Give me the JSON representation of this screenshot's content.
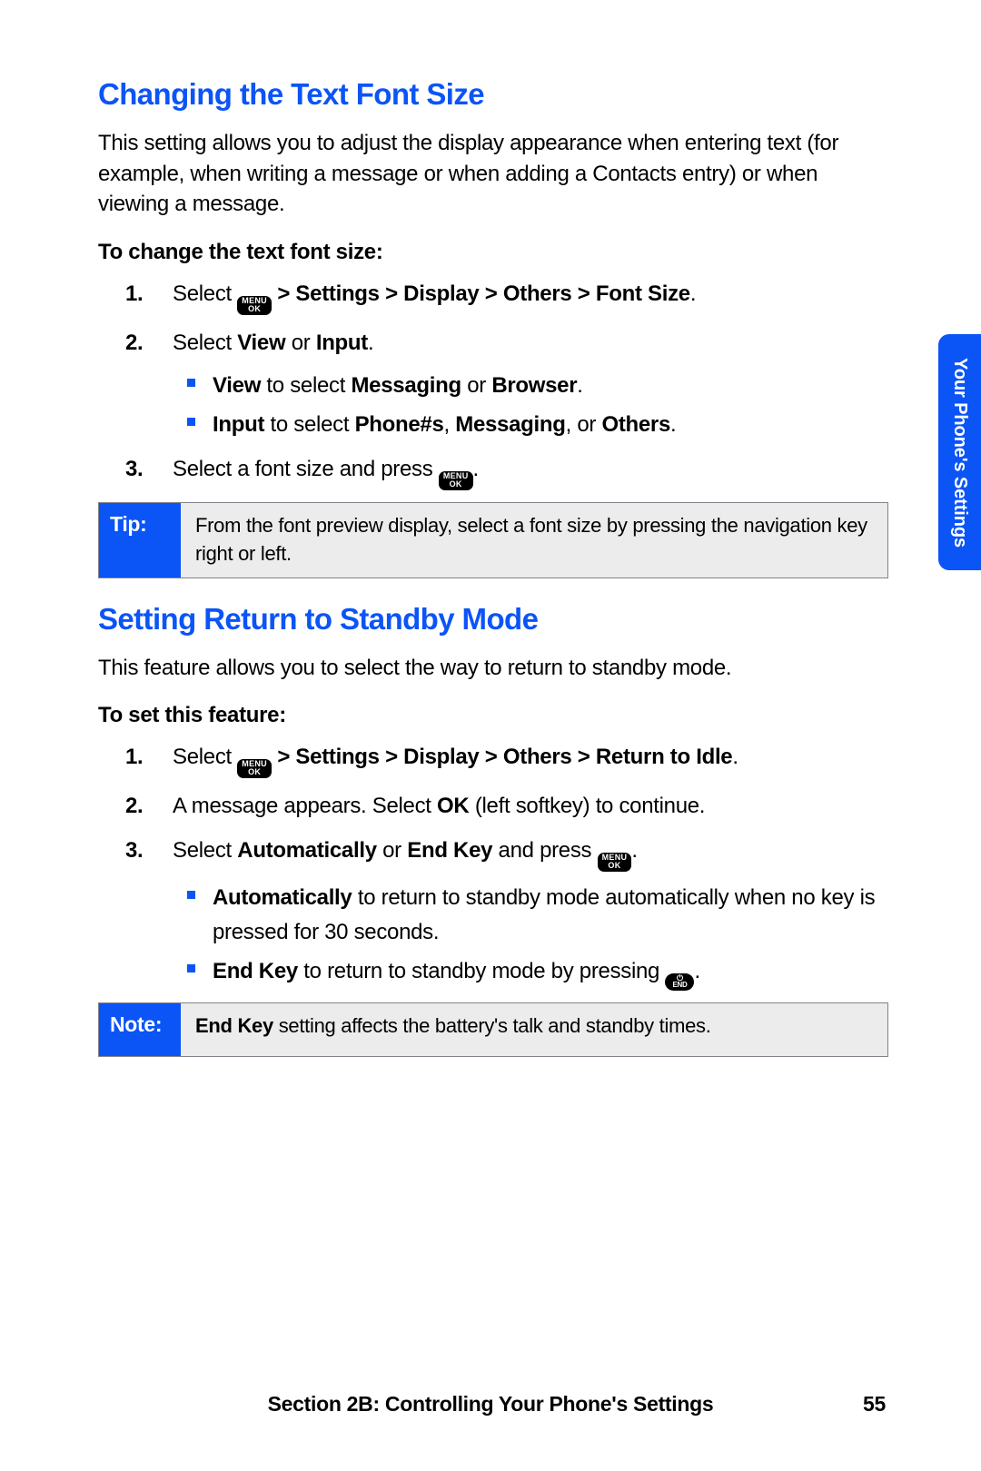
{
  "sidetab": "Your Phone's Settings",
  "footer_text": "Section 2B: Controlling Your Phone's Settings",
  "page_number": "55",
  "keys": {
    "menu_top": "MENU",
    "menu_bot": "OK",
    "end_bot": "END"
  },
  "s1": {
    "heading": "Changing the Text Font Size",
    "intro": "This setting allows you to adjust the display appearance when entering text (for example, when writing a message or when adding a Contacts entry) or when viewing a message.",
    "subhead": "To change the text font size:",
    "step1_a": "Select ",
    "step1_b": " > Settings > Display > Others > Font Size",
    "step2_a": "Select ",
    "step2_b": "View",
    "step2_c": " or ",
    "step2_d": "Input",
    "sub1_a": "View",
    "sub1_b": " to select ",
    "sub1_c": "Messaging",
    "sub1_d": " or ",
    "sub1_e": "Browser",
    "sub2_a": "Input",
    "sub2_b": " to select ",
    "sub2_c": "Phone#s",
    "sub2_d": ", ",
    "sub2_e": "Messaging",
    "sub2_f": ", or ",
    "sub2_g": "Others",
    "step3_a": "Select a font size and press ",
    "tip_label": "Tip:",
    "tip_text": "From the font preview display, select a font size by pressing the navigation key right or left."
  },
  "s2": {
    "heading": "Setting Return to Standby Mode",
    "intro": "This feature allows you to select the way to return to standby mode.",
    "subhead": "To set this feature:",
    "step1_a": "Select ",
    "step1_b": " > Settings > Display > Others > Return to Idle",
    "step2_a": "A message appears. Select ",
    "step2_b": "OK",
    "step2_c": " (left softkey) to continue.",
    "step3_a": "Select ",
    "step3_b": "Automatically",
    "step3_c": " or ",
    "step3_d": "End Key",
    "step3_e": " and press ",
    "sub1_a": "Automatically",
    "sub1_b": " to return to standby mode automatically when no key is pressed for 30 seconds.",
    "sub2_a": "End Key",
    "sub2_b": " to return to standby mode by pressing ",
    "note_label": "Note:",
    "note_a": "End Key",
    "note_b": " setting affects the battery's talk and standby times."
  }
}
